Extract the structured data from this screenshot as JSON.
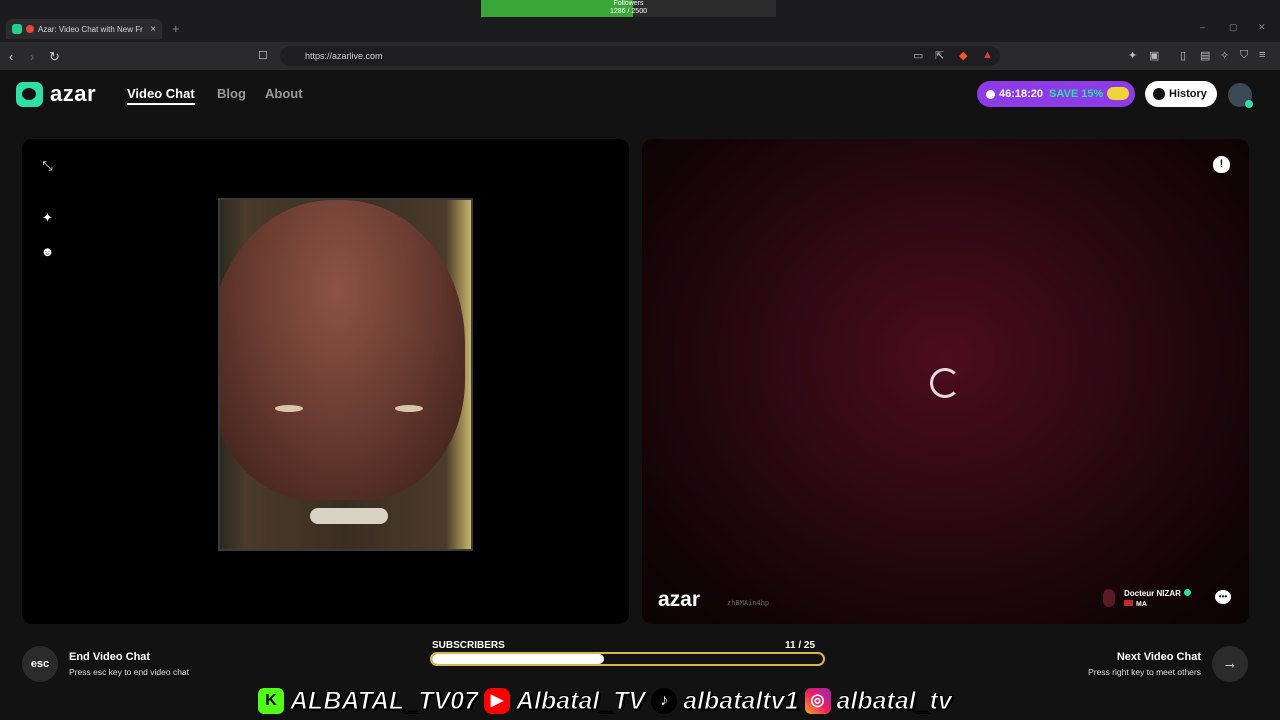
{
  "browser": {
    "tab_title": "Azar: Video Chat with New Fr",
    "tab_close": "×",
    "new_tab": "+",
    "url": "https://azarlive.com",
    "followers_label": "Followers",
    "followers_value": "1286 / 2500",
    "followers_progress": 0.514,
    "win_min": "–",
    "win_max": "▢",
    "win_close": "✕"
  },
  "header": {
    "logo_text": "azar",
    "nav": [
      "Video Chat",
      "Blog",
      "About"
    ],
    "promo_timer": "46:18:20",
    "promo_text": "SAVE 15%",
    "history_label": "History"
  },
  "remote": {
    "watermark": "azar",
    "session_id": "zhBMAin4hp",
    "peer_name": "Docteur NIZAR",
    "peer_country": "MA",
    "report_icon": "!",
    "chat_icon": "•••"
  },
  "controls": {
    "esc_label": "esc",
    "end_title": "End Video Chat",
    "end_sub": "Press esc key to end video chat",
    "next_title": "Next Video Chat",
    "next_sub": "Press right key to meet others",
    "next_arrow": "→"
  },
  "overlay": {
    "subs_label": "SUBSCRIBERS",
    "subs_count": "11   / 25",
    "subs_progress": 0.44,
    "kick": "ALBATAL_TV07",
    "youtube": "Albatal_TV",
    "tiktok": "albataltv1",
    "instagram": "albatal_tv"
  },
  "colors": {
    "accent": "#2fe0a4",
    "promo": "#8d3be6",
    "progress_border": "#d9b650"
  }
}
